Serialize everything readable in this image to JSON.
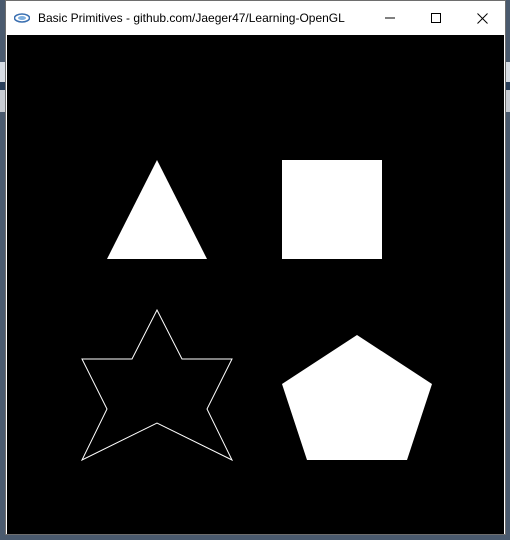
{
  "window": {
    "title": "Basic Primitives - github.com/Jaeger47/Learning-OpenGL",
    "app_icon": "opengl-app-icon",
    "controls": {
      "minimize_icon": "minimize-icon",
      "maximize_icon": "maximize-icon",
      "close_icon": "close-icon"
    }
  },
  "canvas": {
    "background_color": "#000000",
    "fill_color": "#ffffff",
    "shapes": [
      "filled-triangle",
      "filled-square",
      "outlined-star",
      "filled-pentagon"
    ]
  }
}
